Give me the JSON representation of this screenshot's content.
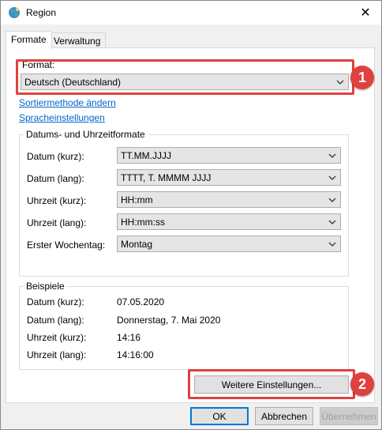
{
  "window": {
    "title": "Region",
    "close_glyph": "✕",
    "app_icon": "globe-icon"
  },
  "tabs": [
    {
      "label": "Formate",
      "active": true
    },
    {
      "label": "Verwaltung",
      "active": false
    }
  ],
  "format": {
    "label": "Format:",
    "selected": "Deutsch (Deutschland)"
  },
  "links": {
    "sort": "Sortiermethode ändern",
    "language": "Spracheinstellungen"
  },
  "formats_group": {
    "title": "Datums- und Uhrzeitformate",
    "rows": [
      {
        "label": "Datum (kurz):",
        "value": "TT.MM.JJJJ"
      },
      {
        "label": "Datum (lang):",
        "value": "TTTT, T. MMMM JJJJ"
      },
      {
        "label": "Uhrzeit (kurz):",
        "value": "HH:mm"
      },
      {
        "label": "Uhrzeit (lang):",
        "value": "HH:mm:ss"
      },
      {
        "label": "Erster Wochentag:",
        "value": "Montag"
      }
    ]
  },
  "examples_group": {
    "title": "Beispiele",
    "rows": [
      {
        "label": "Datum (kurz):",
        "value": "07.05.2020"
      },
      {
        "label": "Datum (lang):",
        "value": "Donnerstag, 7. Mai 2020"
      },
      {
        "label": "Uhrzeit (kurz):",
        "value": "14:16"
      },
      {
        "label": "Uhrzeit (lang):",
        "value": "14:16:00"
      }
    ]
  },
  "more_settings_button": "Weitere Einstellungen...",
  "callouts": [
    "1",
    "2"
  ],
  "footer": {
    "ok": "OK",
    "cancel": "Abbrechen",
    "apply": "Übernehmen"
  },
  "colors": {
    "highlight": "#e0413e",
    "link": "#0066cc",
    "default_button_border": "#0078d7"
  }
}
